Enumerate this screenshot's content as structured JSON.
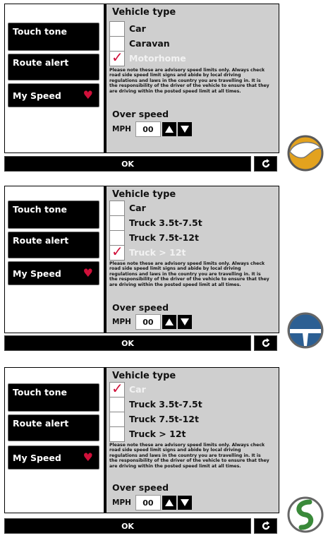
{
  "panels": [
    {
      "sidebar": {
        "touch_tone": "Touch tone",
        "route_alert": "Route alert",
        "my_speed": "My Speed"
      },
      "vehicle_type_title": "Vehicle type",
      "options": [
        {
          "label": "Car",
          "checked": false
        },
        {
          "label": "Caravan",
          "checked": false
        },
        {
          "label": "Motorhome",
          "checked": true
        }
      ],
      "notice": "Please note these are advisory speed limits only. Always check road side speed limit signs and abide by local driving regulations and laws in the country you are travelling in. It is the responsibility of the driver of the vehicle to ensure that they are driving within the posted speed limit at all times.",
      "over_speed_label": "Over speed",
      "unit": "MPH",
      "value": "00",
      "ok_label": "OK",
      "logo": "caravan-logo-icon"
    },
    {
      "sidebar": {
        "touch_tone": "Touch tone",
        "route_alert": "Route alert",
        "my_speed": "My Speed"
      },
      "vehicle_type_title": "Vehicle type",
      "options": [
        {
          "label": "Car",
          "checked": false
        },
        {
          "label": "Truck 3.5t-7.5t",
          "checked": false
        },
        {
          "label": "Truck 7.5t-12t",
          "checked": false
        },
        {
          "label": "Truck > 12t",
          "checked": true
        }
      ],
      "notice": "Please note these are advisory speed limits only. Always check road side speed limit signs and abide by local driving regulations and laws in the country you are travelling in. It is the responsibility of the driver of the vehicle to ensure that they are driving within the posted speed limit at all times.",
      "over_speed_label": "Over speed",
      "unit": "MPH",
      "value": "00",
      "ok_label": "OK",
      "logo": "truck-logo-icon"
    },
    {
      "sidebar": {
        "touch_tone": "Touch tone",
        "route_alert": "Route alert",
        "my_speed": "My Speed"
      },
      "vehicle_type_title": "Vehicle type",
      "options": [
        {
          "label": "Car",
          "checked": true
        },
        {
          "label": "Truck 3.5t-7.5t",
          "checked": false
        },
        {
          "label": "Truck 7.5t-12t",
          "checked": false
        },
        {
          "label": "Truck > 12t",
          "checked": false
        }
      ],
      "notice": "Please note these are advisory speed limits only. Always check road side speed limit signs and abide by local driving regulations and laws in the country you are travelling in. It is the responsibility of the driver of the vehicle to ensure that they are driving within the posted speed limit at all times.",
      "over_speed_label": "Over speed",
      "unit": "MPH",
      "value": "00",
      "ok_label": "OK",
      "logo": "car-logo-icon"
    }
  ],
  "colors": {
    "accent": "#d0103a",
    "panel_bg": "#cfcfcf",
    "button_bg": "#000000"
  }
}
